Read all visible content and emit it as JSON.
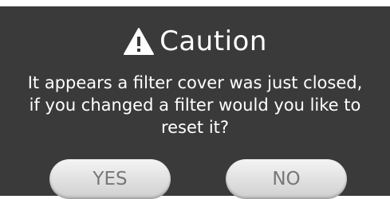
{
  "dialog": {
    "title": "Caution",
    "title_icon": "warning-triangle-icon",
    "message_lines": [
      "It appears a filter cover was just closed,",
      "if you changed a filter would you like to",
      "reset it?"
    ],
    "yes_label": "YES",
    "no_label": "NO"
  },
  "colors": {
    "background": "#3a3a3a",
    "text": "#ffffff",
    "button_fill": "#e2e2e2",
    "button_text": "#777777"
  }
}
